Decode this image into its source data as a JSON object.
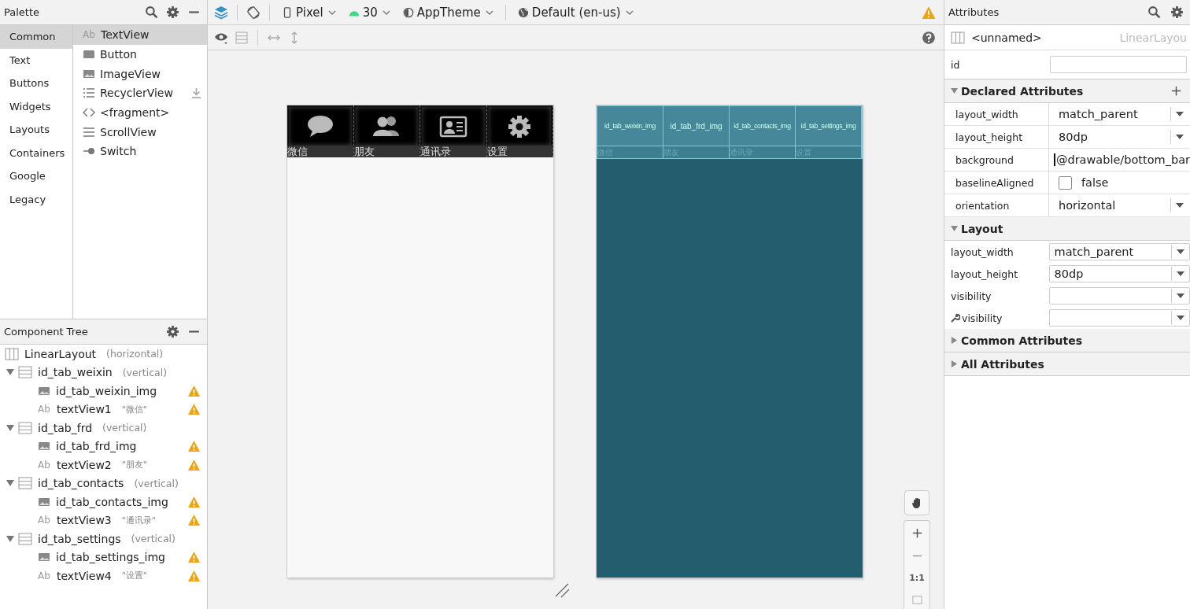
{
  "palette": {
    "title": "Palette",
    "categories": [
      {
        "label": "Common",
        "selected": true
      },
      {
        "label": "Text",
        "selected": false
      },
      {
        "label": "Buttons",
        "selected": false
      },
      {
        "label": "Widgets",
        "selected": false
      },
      {
        "label": "Layouts",
        "selected": false
      },
      {
        "label": "Containers",
        "selected": false
      },
      {
        "label": "Google",
        "selected": false
      },
      {
        "label": "Legacy",
        "selected": false
      }
    ],
    "items": [
      {
        "label": "TextView",
        "kind": "text",
        "glyph": "Ab",
        "selected": true,
        "download": false
      },
      {
        "label": "Button",
        "kind": "button",
        "selected": false,
        "download": false
      },
      {
        "label": "ImageView",
        "kind": "image",
        "selected": false,
        "download": false
      },
      {
        "label": "RecyclerView",
        "kind": "list",
        "selected": false,
        "download": true
      },
      {
        "label": "<fragment>",
        "kind": "fragment",
        "selected": false,
        "download": false
      },
      {
        "label": "ScrollView",
        "kind": "scroll",
        "selected": false,
        "download": false
      },
      {
        "label": "Switch",
        "kind": "switch",
        "selected": false,
        "download": false
      }
    ]
  },
  "component_tree": {
    "title": "Component Tree",
    "root": {
      "name": "LinearLayout",
      "note": "(horizontal)",
      "kind": "hlayout",
      "children": [
        {
          "name": "id_tab_weixin",
          "note": "(vertical)",
          "kind": "vlayout",
          "expanded": true,
          "children": [
            {
              "name": "id_tab_weixin_img",
              "kind": "image",
              "warning": true
            },
            {
              "name": "textView1",
              "note": "\"微信\"",
              "kind": "text",
              "glyph": "Ab",
              "warning": true
            }
          ]
        },
        {
          "name": "id_tab_frd",
          "note": "(vertical)",
          "kind": "vlayout",
          "expanded": true,
          "children": [
            {
              "name": "id_tab_frd_img",
              "kind": "image",
              "warning": true
            },
            {
              "name": "textView2",
              "note": "\"朋友\"",
              "kind": "text",
              "glyph": "Ab",
              "warning": true
            }
          ]
        },
        {
          "name": "id_tab_contacts",
          "note": "(vertical)",
          "kind": "vlayout",
          "expanded": true,
          "children": [
            {
              "name": "id_tab_contacts_img",
              "kind": "image",
              "warning": true
            },
            {
              "name": "textView3",
              "note": "\"通讯录\"",
              "kind": "text",
              "glyph": "Ab",
              "warning": true
            }
          ]
        },
        {
          "name": "id_tab_settings",
          "note": "(vertical)",
          "kind": "vlayout",
          "expanded": true,
          "children": [
            {
              "name": "id_tab_settings_img",
              "kind": "image",
              "warning": true
            },
            {
              "name": "textView4",
              "note": "\"设置\"",
              "kind": "text",
              "glyph": "Ab",
              "warning": true
            }
          ]
        }
      ]
    }
  },
  "toolbar": {
    "device": "Pixel",
    "api": "30",
    "theme": "AppTheme",
    "locale": "Default (en-us)",
    "warning": true
  },
  "canvas": {
    "tabs": [
      {
        "label": "微信",
        "kind": "chat"
      },
      {
        "label": "朋友",
        "kind": "people"
      },
      {
        "label": "通讯录",
        "kind": "contact"
      },
      {
        "label": "设置",
        "kind": "gear"
      }
    ],
    "blueprint_tabs": [
      {
        "label": "微信",
        "img_label": "id_tab_weixin_img"
      },
      {
        "label": "朋友",
        "img_label": "id_tab_frd_img"
      },
      {
        "label": "通讯录",
        "img_label": "id_tab_contacts_img"
      },
      {
        "label": "设置",
        "img_label": "id_tab_settings_img"
      }
    ],
    "zoom": {
      "reset": "1:1"
    }
  },
  "attributes": {
    "title": "Attributes",
    "component": "<unnamed>",
    "component_type": "LinearLayou",
    "id_label": "id",
    "sections": [
      {
        "title": "Declared Attributes",
        "expanded": true,
        "addable": true,
        "rows": [
          {
            "kind": "dropdown",
            "name": "layout_width",
            "value": "match_parent"
          },
          {
            "kind": "dropdown",
            "name": "layout_height",
            "value": "80dp"
          },
          {
            "kind": "resource",
            "name": "background",
            "value": "@drawable/bottom_bar"
          },
          {
            "kind": "checkbox",
            "name": "baselineAligned",
            "value": "false",
            "checked": false
          },
          {
            "kind": "dropdown",
            "name": "orientation",
            "value": "horizontal"
          }
        ]
      },
      {
        "title": "Layout",
        "expanded": true,
        "addable": false,
        "rows": [
          {
            "kind": "combo",
            "name": "layout_width",
            "value": "match_parent",
            "tool": false
          },
          {
            "kind": "combo",
            "name": "layout_height",
            "value": "80dp",
            "tool": false
          },
          {
            "kind": "combo",
            "name": "visibility",
            "tool": false
          },
          {
            "kind": "combo",
            "name": "visibility",
            "tool": true
          }
        ]
      },
      {
        "title": "Common Attributes",
        "expanded": false,
        "addable": false
      },
      {
        "title": "All Attributes",
        "expanded": false,
        "addable": false
      }
    ]
  }
}
